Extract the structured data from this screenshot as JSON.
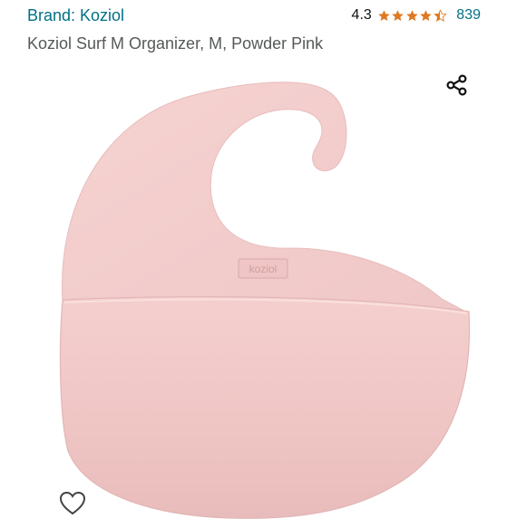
{
  "header": {
    "brand": "Brand: Koziol",
    "rating_value": "4.3",
    "stars": 4.3,
    "review_count": "839"
  },
  "product": {
    "title": "Koziol Surf M Organizer, M, Powder Pink",
    "logo_text": "koziol"
  },
  "colors": {
    "link": "#007185",
    "star": "#de7921",
    "product_pink": "#f2cdcc"
  },
  "icons": {
    "share": "share-icon",
    "wishlist": "heart-outline-icon"
  }
}
